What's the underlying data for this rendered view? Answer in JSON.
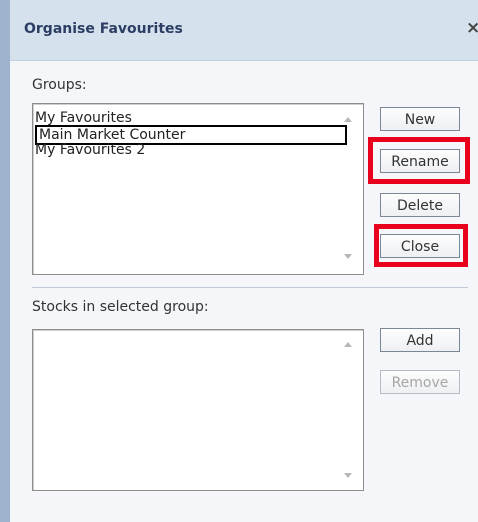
{
  "window": {
    "title": "Organise Favourites",
    "close_glyph": "×"
  },
  "groups": {
    "label": "Groups:",
    "items": [
      {
        "label": "My Favourites"
      },
      {
        "label": "Main Market Counter",
        "selected": true
      },
      {
        "label": "My Favourites 2"
      }
    ]
  },
  "buttons": {
    "new": "New",
    "rename": "Rename",
    "delete": "Delete",
    "close": "Close",
    "add": "Add",
    "remove": "Remove"
  },
  "stocks": {
    "label": "Stocks in selected group:",
    "items": []
  },
  "annotations": {
    "highlight_color": "#e8001c",
    "highlighted": [
      "rename",
      "close"
    ]
  },
  "icons": {
    "close": "close-icon",
    "scroll_up": "scroll-up-icon",
    "scroll_down": "scroll-down-icon"
  }
}
